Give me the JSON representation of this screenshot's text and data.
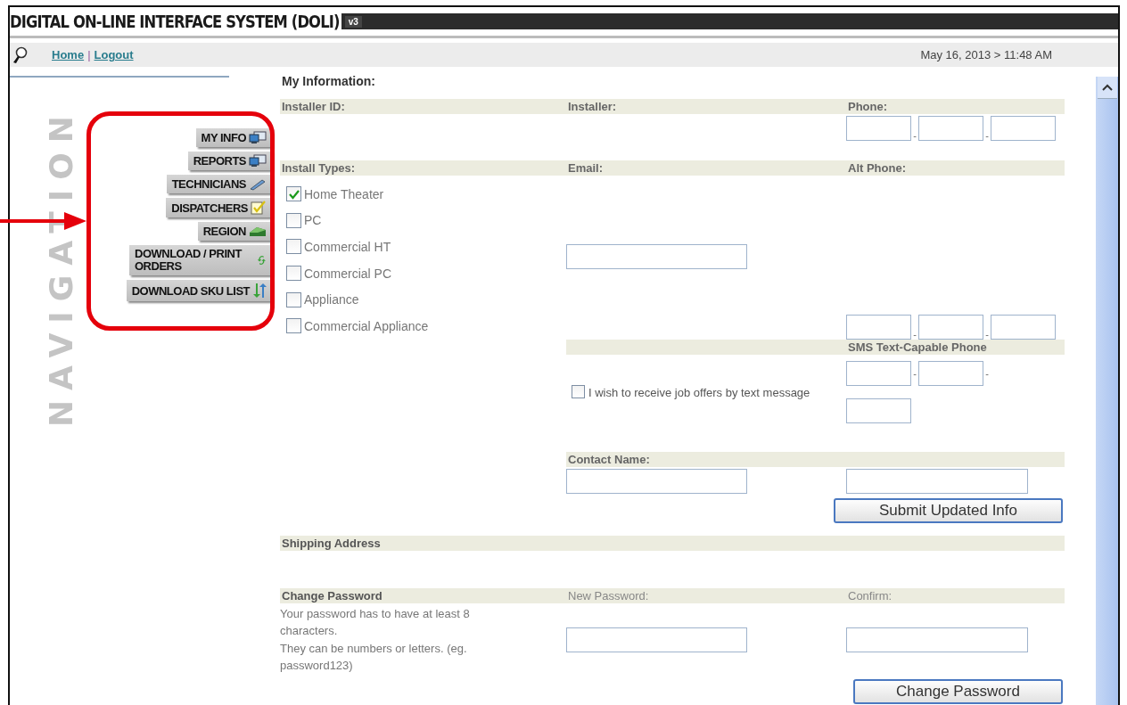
{
  "header": {
    "title": "DIGITAL ON-LINE INTERFACE SYSTEM (DOLI)",
    "version": "v3"
  },
  "topbar": {
    "links": [
      {
        "label": "Home"
      },
      {
        "label": "Logout"
      }
    ],
    "separator": "|",
    "datetime": "May 16, 2013 > 11:48 AM"
  },
  "sidebar": {
    "watermark": "NAVIGATION",
    "items": [
      {
        "label": "MY INFO",
        "kind": "monitor"
      },
      {
        "label": "REPORTS",
        "kind": "monitor"
      },
      {
        "label": "TECHNICIANS",
        "kind": "pencil"
      },
      {
        "label": "DISPATCHERS",
        "kind": "note"
      },
      {
        "label": "REGION",
        "kind": "block"
      },
      {
        "label": "DOWNLOAD / PRINT ORDERS",
        "kind": "refresh"
      },
      {
        "label": "DOWNLOAD SKU LIST",
        "kind": "updown"
      }
    ]
  },
  "form": {
    "title": "My Information:",
    "installer_id": {
      "label": "Installer ID:"
    },
    "installer": {
      "label": "Installer:"
    },
    "phone": {
      "label": "Phone:",
      "separators": [
        "-",
        "-"
      ]
    },
    "install_types": {
      "label": "Install Types:",
      "items": [
        {
          "label": "Home Theater",
          "checked": true
        },
        {
          "label": "PC",
          "checked": false
        },
        {
          "label": "Commercial HT",
          "checked": false
        },
        {
          "label": "Commercial PC",
          "checked": false
        },
        {
          "label": "Appliance",
          "checked": false
        },
        {
          "label": "Commercial Appliance",
          "checked": false
        }
      ]
    },
    "email": {
      "label": "Email:"
    },
    "alt_phone": {
      "label": "Alt Phone:",
      "separators": [
        "-",
        "-"
      ]
    },
    "sms_phone": {
      "label": "SMS Text-Capable Phone",
      "separators": [
        "-",
        "-"
      ]
    },
    "text_opt_in": {
      "label": "I wish to receive job offers by text message",
      "checked": false
    },
    "contact_name": {
      "label": "Contact Name:"
    },
    "submit_button": "Submit Updated Info"
  },
  "shipping": {
    "title": "Shipping Address"
  },
  "password": {
    "title": "Change Password",
    "new_label": "New Password:",
    "confirm_label": "Confirm:",
    "help": [
      "Your password has to have at least 8 characters.",
      "They can be numbers or letters. (eg. password123)"
    ],
    "button": "Change Password"
  }
}
